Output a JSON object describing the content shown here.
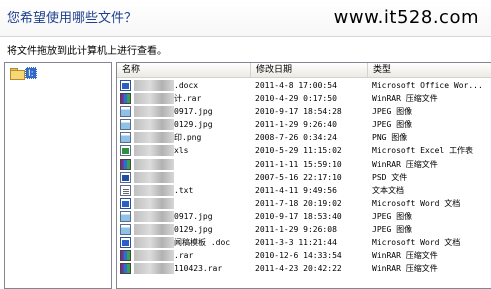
{
  "header": {
    "title": "您希望使用哪些文件？",
    "watermark": "www.it528.com"
  },
  "instruction": "将文件拖放到此计算机上进行查看。",
  "tree": {
    "selected_label": "I:"
  },
  "columns": {
    "name": "名称",
    "date": "修改日期",
    "type": "类型"
  },
  "files": [
    {
      "name_fragment": ".docx",
      "date": "2011-4-8 17:00:54",
      "type": "Microsoft Office Wor...",
      "icon": "word"
    },
    {
      "name_fragment": "计.rar",
      "date": "2010-4-29 0:17:50",
      "type": "WinRAR 压缩文件",
      "icon": "rar"
    },
    {
      "name_fragment": "0917.jpg",
      "date": "2010-9-17 18:54:28",
      "type": "JPEG 图像",
      "icon": "img"
    },
    {
      "name_fragment": "0129.jpg",
      "date": "2011-1-29 9:26:40",
      "type": "JPEG 图像",
      "icon": "img"
    },
    {
      "name_fragment": "印.png",
      "date": "2008-7-26 0:34:24",
      "type": "PNG 图像",
      "icon": "img"
    },
    {
      "name_fragment": "xls",
      "date": "2010-5-29 11:15:02",
      "type": "Microsoft Excel 工作表",
      "icon": "xls"
    },
    {
      "name_fragment": "",
      "date": "2011-1-11 15:59:10",
      "type": "WinRAR 压缩文件",
      "icon": "rar"
    },
    {
      "name_fragment": "",
      "date": "2007-5-16 22:17:10",
      "type": "PSD 文件",
      "icon": "psd"
    },
    {
      "name_fragment": ".txt",
      "date": "2011-4-11 9:49:56",
      "type": "文本文档",
      "icon": "txt"
    },
    {
      "name_fragment": "",
      "date": "2011-7-18 20:19:02",
      "type": "Microsoft Word 文档",
      "icon": "word"
    },
    {
      "name_fragment": "0917.jpg",
      "date": "2010-9-17 18:53:40",
      "type": "JPEG 图像",
      "icon": "img"
    },
    {
      "name_fragment": "0129.jpg",
      "date": "2011-1-29 9:26:08",
      "type": "JPEG 图像",
      "icon": "img"
    },
    {
      "name_fragment": "闻稿模板 .doc",
      "date": "2011-3-3 11:21:44",
      "type": "Microsoft Word 文档",
      "icon": "word"
    },
    {
      "name_fragment": ".rar",
      "date": "2010-12-6 14:33:54",
      "type": "WinRAR 压缩文件",
      "icon": "rar"
    },
    {
      "name_fragment": "110423.rar",
      "date": "2011-4-23 20:42:22",
      "type": "WinRAR 压缩文件",
      "icon": "rar"
    }
  ]
}
